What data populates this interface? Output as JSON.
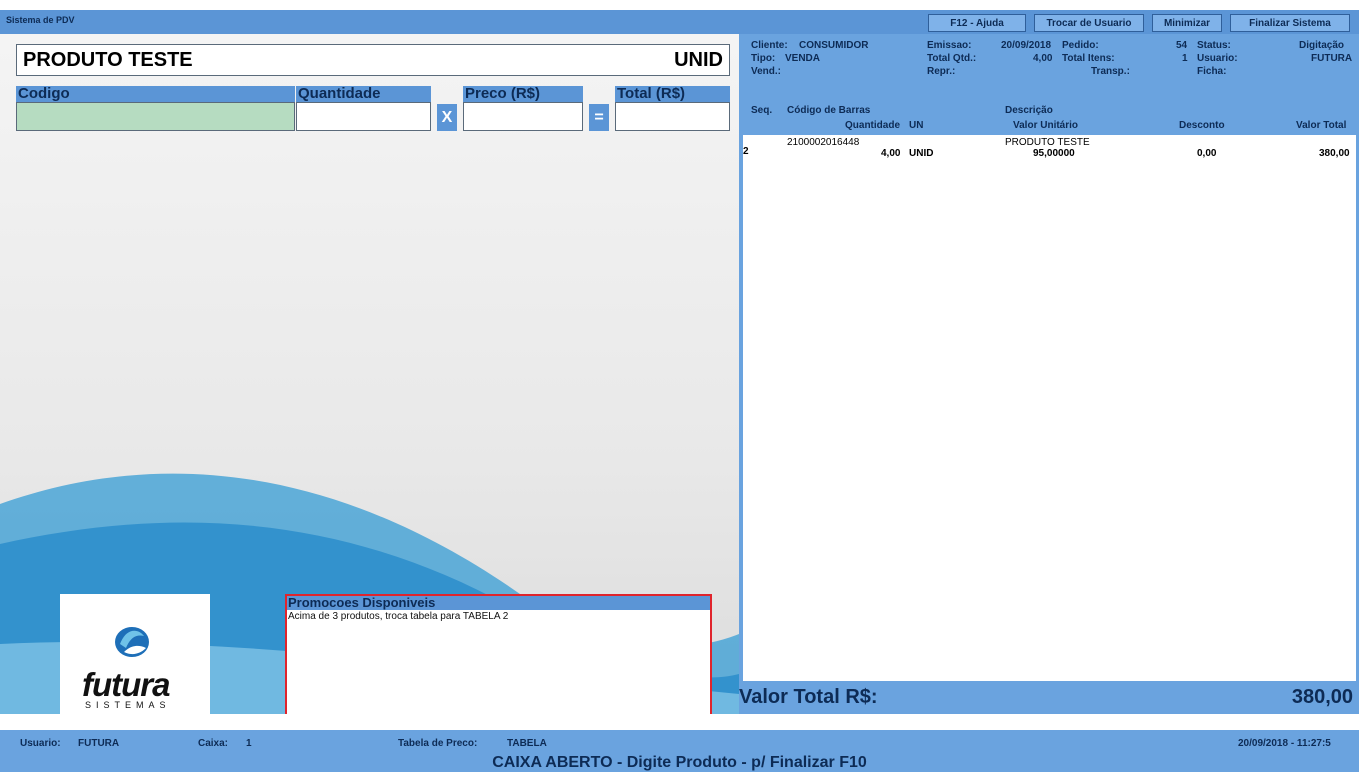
{
  "app": {
    "title": "Sistema de PDV"
  },
  "toolbar": {
    "help": "F12 - Ajuda",
    "switch_user": "Trocar de Usuario",
    "minimize": "Minimizar",
    "exit": "Finalizar Sistema"
  },
  "product": {
    "name": "PRODUTO TESTE",
    "unit": "UNID"
  },
  "fields": {
    "code_label": "Codigo",
    "qty_label": "Quantidade",
    "price_label": "Preco (R$)",
    "total_label": "Total (R$)",
    "times": "X",
    "equals": "=",
    "code_value": "",
    "qty_value": "",
    "price_value": "",
    "total_value": ""
  },
  "logo": {
    "brand": "futura",
    "sub": "SISTEMAS"
  },
  "promo": {
    "title": "Promocoes Disponiveis",
    "text": "Acima de 3 produtos, troca tabela para TABELA 2"
  },
  "order": {
    "client_label": "Cliente:",
    "client": "CONSUMIDOR",
    "type_label": "Tipo:",
    "type": "VENDA",
    "seller_label": "Vend.:",
    "issue_label": "Emissao:",
    "issue": "20/09/2018",
    "totalqty_label": "Total Qtd.:",
    "totalqty": "4,00",
    "rep_label": "Repr.:",
    "order_label": "Pedido:",
    "order_no": "54",
    "items_label": "Total Itens:",
    "items_count": "1",
    "transp_label": "Transp.:",
    "status_label": "Status:",
    "status": "Digitação",
    "user_label": "Usuario:",
    "user": "FUTURA",
    "sheet_label": "Ficha:"
  },
  "table": {
    "headers": {
      "seq": "Seq.",
      "barcode": "Código de Barras",
      "description": "Descrição",
      "quantity": "Quantidade",
      "un": "UN",
      "unit_value": "Valor Unitário",
      "discount": "Desconto",
      "total": "Valor Total"
    },
    "rows": [
      {
        "seq": "2",
        "barcode": "2100002016448",
        "description": "PRODUTO TESTE",
        "quantity": "4,00",
        "un": "UNID",
        "unit_value": "95,00000",
        "discount": "0,00",
        "total": "380,00"
      }
    ]
  },
  "total": {
    "label": "Valor Total R$:",
    "value": "380,00"
  },
  "status": {
    "user_label": "Usuario:",
    "user": "FUTURA",
    "cash_label": "Caixa:",
    "cash": "1",
    "price_table_label": "Tabela de Preco:",
    "price_table": "TABELA",
    "datetime": "20/09/2018 - 11:27:5",
    "message": "CAIXA ABERTO - Digite Produto - p/ Finalizar F10"
  },
  "colors": {
    "primary": "#5b95d6",
    "panel": "#6aa3df",
    "code_input": "#b6dcc1",
    "promo_border": "#e0242c",
    "text": "#0d2b55"
  }
}
